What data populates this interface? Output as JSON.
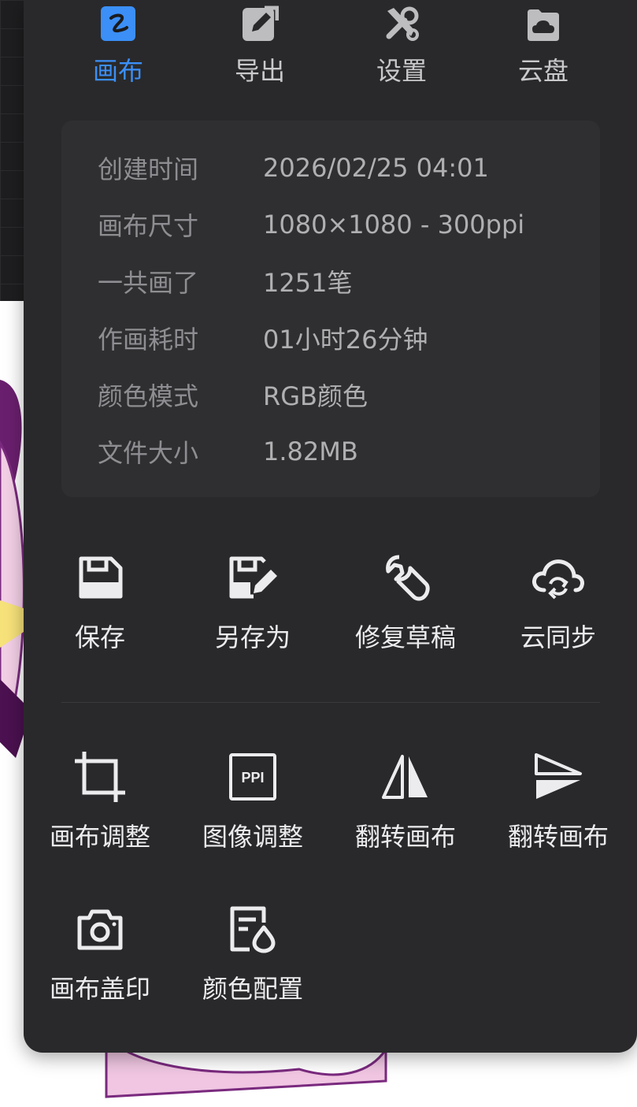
{
  "tabs": [
    {
      "label": "画布",
      "icon": "canvas-icon",
      "active": true
    },
    {
      "label": "导出",
      "icon": "export-icon",
      "active": false
    },
    {
      "label": "设置",
      "icon": "settings-icon",
      "active": false
    },
    {
      "label": "云盘",
      "icon": "cloud-disk-icon",
      "active": false
    }
  ],
  "info": {
    "rows": [
      {
        "key": "创建时间",
        "value": "2026/02/25 04:01"
      },
      {
        "key": "画布尺寸",
        "value": "1080×1080 - 300ppi"
      },
      {
        "key": "一共画了",
        "value": "1251笔"
      },
      {
        "key": "作画耗时",
        "value": "01小时26分钟"
      },
      {
        "key": "颜色模式",
        "value": "RGB颜色"
      },
      {
        "key": "文件大小",
        "value": "1.82MB"
      }
    ]
  },
  "actions": [
    {
      "label": "保存",
      "icon": "save-icon"
    },
    {
      "label": "另存为",
      "icon": "save-as-icon"
    },
    {
      "label": "修复草稿",
      "icon": "repair-wrench-icon"
    },
    {
      "label": "云同步",
      "icon": "cloud-sync-icon"
    }
  ],
  "tools": [
    {
      "label": "画布调整",
      "icon": "crop-icon"
    },
    {
      "label": "图像调整",
      "icon": "ppi-icon",
      "icon_text": "PPI"
    },
    {
      "label": "翻转画布",
      "icon": "flip-horizontal-icon"
    },
    {
      "label": "翻转画布",
      "icon": "flip-vertical-icon"
    },
    {
      "label": "画布盖印",
      "icon": "camera-icon"
    },
    {
      "label": "颜色配置",
      "icon": "color-profile-icon"
    }
  ],
  "colors": {
    "panel": "#29292b",
    "card": "#2f2f31",
    "accent": "#3b8ff7"
  }
}
